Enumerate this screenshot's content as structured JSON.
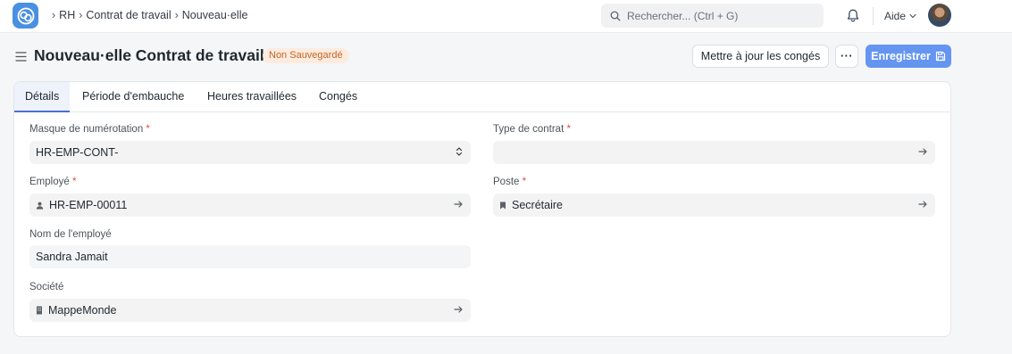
{
  "navbar": {
    "breadcrumbs": [
      "RH",
      "Contrat de travail",
      "Nouveau·elle"
    ],
    "search_placeholder": "Rechercher... (Ctrl + G)",
    "help_label": "Aide"
  },
  "header": {
    "title": "Nouveau·elle Contrat de travail",
    "status_badge": "Non Sauvegardé",
    "update_leaves_label": "Mettre à jour les congés",
    "more_label": "···",
    "save_label": "Enregistrer"
  },
  "tabs": [
    {
      "label": "Détails",
      "active": true
    },
    {
      "label": "Période d'embauche",
      "active": false
    },
    {
      "label": "Heures travaillées",
      "active": false
    },
    {
      "label": "Congés",
      "active": false
    }
  ],
  "form": {
    "naming_series": {
      "label": "Masque de numérotation",
      "required": "*",
      "value": "HR-EMP-CONT-"
    },
    "contract_type": {
      "label": "Type de contrat",
      "required": "*",
      "value": ""
    },
    "employee": {
      "label": "Employé",
      "required": "*",
      "value": "HR-EMP-00011"
    },
    "designation": {
      "label": "Poste",
      "required": "*",
      "value": "Secrétaire"
    },
    "employee_name": {
      "label": "Nom de l'employé",
      "value": "Sandra Jamait"
    },
    "company": {
      "label": "Société",
      "value": "MappeMonde"
    }
  }
}
